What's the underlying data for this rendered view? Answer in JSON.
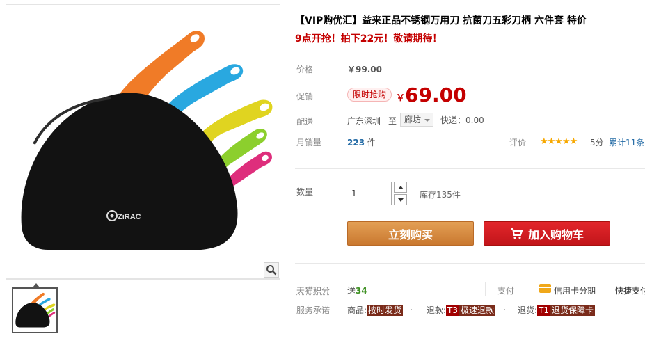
{
  "product": {
    "title": "【VIP购优汇】益来正品不锈钢万用刀 抗菌刀五彩刀柄 六件套 特价",
    "subtitle": "9点开抢！拍下22元！敬请期待！",
    "logo_text": "ZiRAC"
  },
  "price_row": {
    "label": "价格",
    "original": "￥99.00"
  },
  "promo_row": {
    "label": "促销",
    "badge": "限时抢购",
    "currency": "￥",
    "price": "69.00"
  },
  "shipping_row": {
    "label": "配送",
    "from": "广东深圳",
    "to_word": "至",
    "destination": "廊坊",
    "express": "快递：0.00"
  },
  "sales_row": {
    "label": "月销量",
    "count": "223",
    "unit": "件",
    "rating_label": "评价",
    "stars": "★★★★★",
    "score": "5分",
    "total": "累计11条"
  },
  "quantity": {
    "label": "数量",
    "value": "1",
    "stock": "库存135件"
  },
  "buttons": {
    "buy_now": "立刻购买",
    "add_cart": "加入购物车"
  },
  "points_row": {
    "label": "天猫积分",
    "prefix": "送",
    "points": "34",
    "pay_label": "支付",
    "credit": "信用卡分期",
    "quick": "快捷支付"
  },
  "service_row": {
    "label": "服务承诺",
    "goods_label": "商品:",
    "goods_tag": "按时发货",
    "refund_label": "退款:",
    "refund_code": "T3",
    "refund_tag": "极速退款",
    "return_label": "退货:",
    "return_code": "T1",
    "return_tag": "退货保障卡"
  },
  "colors": {
    "accent_red": "#c40000",
    "buy_orange": "#d58a42",
    "cart_red": "#d11d22"
  }
}
